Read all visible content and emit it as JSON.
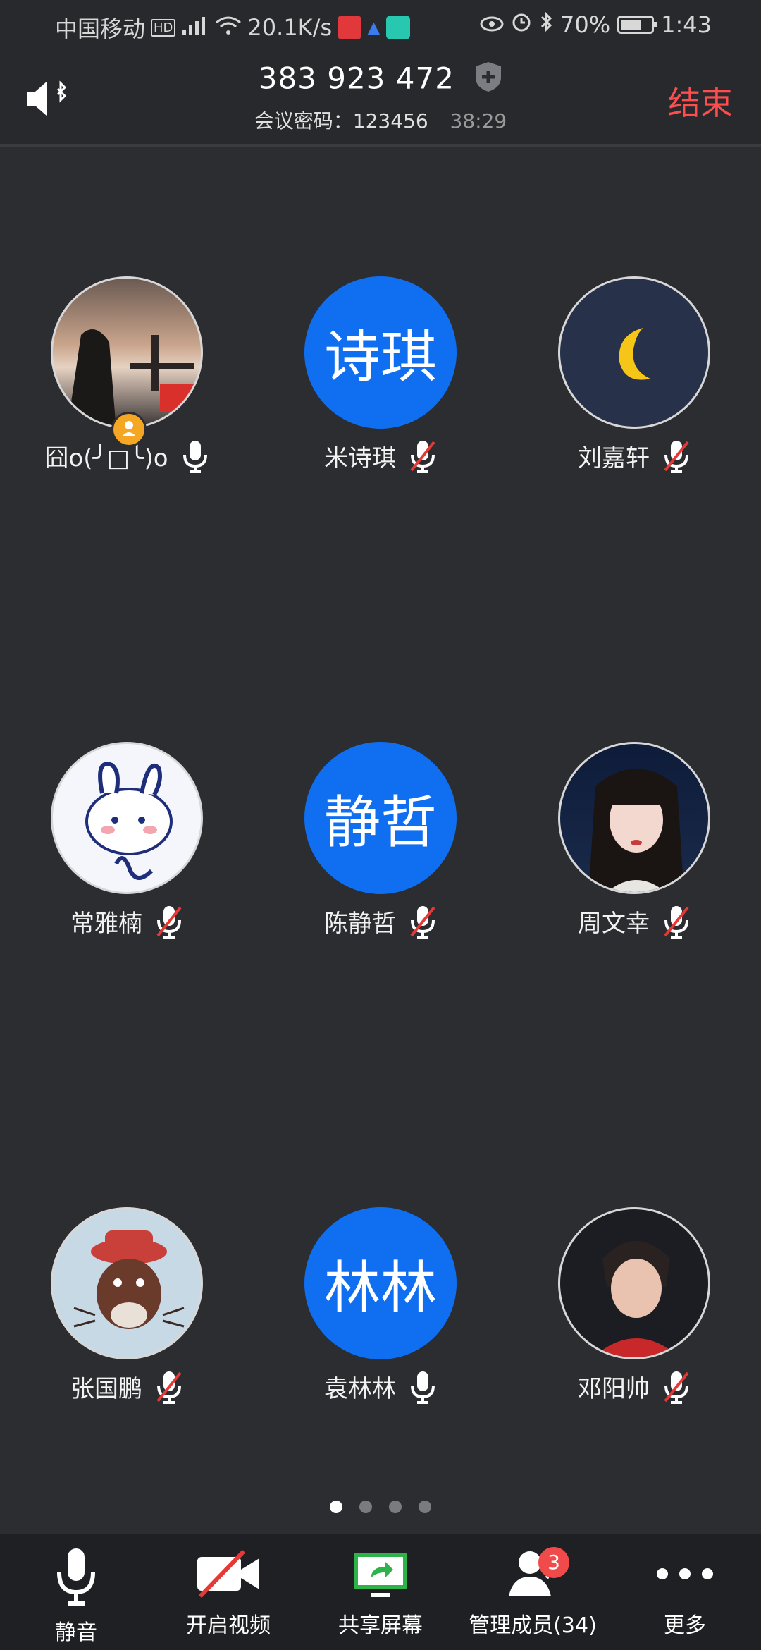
{
  "status_bar": {
    "carrier": "中国移动",
    "hd": "HD",
    "net_speed": "20.1K/s",
    "battery": "70%",
    "time": "1:43"
  },
  "meeting": {
    "id": "383 923 472",
    "password_label": "会议密码：",
    "password": "123456",
    "elapsed": "38:29",
    "end_label": "结束"
  },
  "participants": [
    {
      "name": "囧o(╯□╰)o",
      "avatar_text": "",
      "mic": "on"
    },
    {
      "name": "米诗琪",
      "avatar_text": "诗琪",
      "mic": "muted"
    },
    {
      "name": "刘嘉轩",
      "avatar_text": "",
      "mic": "muted"
    },
    {
      "name": "常雅楠",
      "avatar_text": "",
      "mic": "muted"
    },
    {
      "name": "陈静哲",
      "avatar_text": "静哲",
      "mic": "muted"
    },
    {
      "name": "周文幸",
      "avatar_text": "",
      "mic": "muted"
    },
    {
      "name": "张国鹏",
      "avatar_text": "",
      "mic": "muted"
    },
    {
      "name": "袁林林",
      "avatar_text": "林林",
      "mic": "on"
    },
    {
      "name": "邓阳帅",
      "avatar_text": "",
      "mic": "muted"
    }
  ],
  "pagination": {
    "pages": 4,
    "current": 1
  },
  "toolbar": {
    "mute_label": "静音",
    "video_label": "开启视频",
    "share_label": "共享屏幕",
    "members_label": "管理成员(34)",
    "members_badge": "3",
    "more_label": "更多"
  },
  "colors": {
    "accent_blue": "#0f6ff0",
    "end_red": "#ff4d4d",
    "share_green": "#2db34a",
    "badge_red": "#f04a4a"
  }
}
